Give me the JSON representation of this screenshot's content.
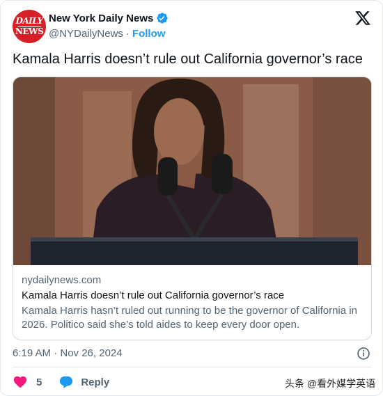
{
  "account": {
    "name": "New York Daily News",
    "handle": "@NYDailyNews",
    "separator": "·",
    "follow_label": "Follow",
    "logo_line1": "DAILY",
    "logo_line2": "NEWS",
    "brand_color": "#d61f26",
    "verified_color": "#1d9bf0"
  },
  "tweet": {
    "text": "Kamala Harris doesn’t rule out California governor’s race"
  },
  "link_card": {
    "domain": "nydailynews.com",
    "title": "Kamala Harris doesn’t rule out California governor’s race",
    "description": "Kamala Harris hasn’t ruled out running to be the governor of California in 2026. Politico said she’s told aides to keep every door open."
  },
  "footer": {
    "timestamp": "6:19 AM · Nov 26, 2024",
    "like_count": "5",
    "reply_label": "Reply"
  },
  "watermark": "头条 @看外媒学英语",
  "icons": {
    "x_logo": "x-logo-icon",
    "verified": "verified-badge-icon",
    "info": "info-icon",
    "heart": "heart-icon",
    "reply": "reply-bubble-icon"
  },
  "colors": {
    "heart": "#f91880",
    "reply": "#1d9bf0",
    "link": "#1d9bf0"
  }
}
